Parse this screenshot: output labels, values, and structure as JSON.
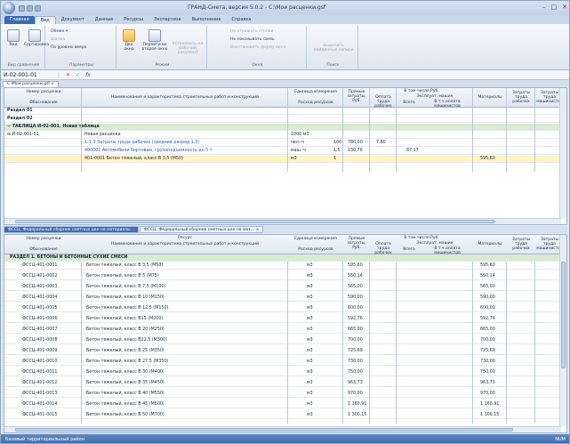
{
  "title": "ГРАНД-Смета, версия 5.0.2 - C:\\Мои расценки.gsf",
  "ribbon": {
    "tabs": [
      "Главная",
      "Вид",
      "Документ",
      "Данные",
      "Ресурсы",
      "Экспертиза",
      "Выполнение",
      "Справка"
    ],
    "groups": [
      {
        "label": "Вид сравнения",
        "buttons": [
          "Вид",
          "Сортировка"
        ]
      },
      {
        "label": "Параметры",
        "buttons": [
          "Обмен ▾",
          "Шапка",
          "По уровню вверх"
        ]
      },
      {
        "label": "Режим",
        "buttons": [
          "Два окна",
          "Перейти во второе окно",
          "Установить на рабочий документ"
        ]
      },
      {
        "label": "Окна",
        "buttons": [
          "Не отражать строки",
          "Не показывать связь",
          "Восстановить форму окна"
        ]
      },
      {
        "label": "Поиск",
        "buttons": [
          "Выделить найденные записи"
        ]
      }
    ]
  },
  "formula_bar": {
    "cell": "И-02-001-01",
    "value": ""
  },
  "doc_tab": "C:\\Мои расценки.gsf",
  "upper_table": {
    "headers": {
      "num": "Номер расценки",
      "basis": "Обоснование",
      "name": "Наименование и характеристика строительных работ и конструкций",
      "unit": "Единица измерения",
      "consumption": "Расход ресурсов",
      "direct": "Прямые затраты, Руб.",
      "incl": "В том числе,Руб.",
      "wage": "Оплата труда рабочих",
      "machines": "Эксплуат. машин",
      "total": "Всего",
      "incl_wage": "В т.ч.оплата машинистов",
      "materials": "Материалы",
      "labor_workers": "Затраты труда рабочих",
      "labor_machinists": "Затраты труда машинистов"
    },
    "rows": [
      {
        "type": "bold",
        "basis": "Раздел 01",
        "name": "",
        "unit": "",
        "cons": "",
        "direct": "",
        "wage": "",
        "total": "",
        "incl": "",
        "mat": ""
      },
      {
        "type": "bold",
        "basis": "Раздел 02",
        "name": "",
        "unit": "",
        "cons": "",
        "direct": "",
        "wage": "",
        "total": "",
        "incl": "",
        "mat": ""
      },
      {
        "type": "group",
        "basis": "−  ТАБЛИЦА И-02-001. Новая таблица",
        "name": "",
        "unit": "",
        "cons": "",
        "direct": "",
        "wage": "",
        "total": "",
        "incl": "",
        "mat": ""
      },
      {
        "type": "normal",
        "basis": "⊟  И-02-001-01",
        "name": "Новая расценка",
        "unit": "1000 м3",
        "cons": "",
        "direct": "",
        "wage": "",
        "total": "",
        "incl": "",
        "mat": ""
      },
      {
        "type": "blue",
        "basis": "",
        "name": "1-1-3 Затраты труда рабочих (средний разряд 1,3)",
        "unit": "чел.-ч",
        "cons": "100",
        "direct": "780,00",
        "wage": "7,80",
        "total": "",
        "incl": "",
        "mat": ""
      },
      {
        "type": "blue",
        "basis": "",
        "name": "400001 Автомобили бортовые, грузоподъемность до 5 т",
        "unit": "маш.-ч",
        "cons": "1,5",
        "direct": "130,76",
        "wage": "",
        "total": "87,17",
        "incl": "",
        "mat": ""
      },
      {
        "type": "sel",
        "basis": "",
        "name": "401-0001 Бетон тяжелый, класс В 3,5 (М50)",
        "unit": "м3",
        "cons": "1",
        "direct": "",
        "wage": "",
        "total": "",
        "incl": "",
        "mat": "595,60"
      }
    ]
  },
  "lower_tabs": [
    "ФССЦ. Федеральный сборник сметных цен на материалы...",
    "ФССЦ. Федеральный сборник сметных цен на мат...  ×"
  ],
  "lower_table": {
    "headers": {
      "num": "Номер расценки",
      "basis": "Обоснование",
      "resource": "Ресурс",
      "name": "Наименование и характеристика строительных работ и конструкций",
      "unit": "Единица измерения",
      "consumption": "Расход ресурсов",
      "direct": "Прямые затраты, Руб.",
      "incl": "В том числе,Руб.",
      "wage": "Оплата труда рабочих",
      "machines": "Эксплуат. машин",
      "total": "Всего",
      "incl_wage": "В т.ч.оплата машинистов",
      "materials": "Материалы",
      "labor_workers": "Затраты труда рабочих",
      "labor_machinists": "Затраты труда машинистов"
    },
    "section": "РАЗДЕЛ 1. БЕТОНЫ И БЕТОННЫЕ СУХИЕ СМЕСИ",
    "rows": [
      {
        "code": "ФССЦ-401-0001",
        "name": "Бетон тяжелый, класс В 3,5 (М50)",
        "unit": "м3",
        "direct": "595,60",
        "mat": "595,60"
      },
      {
        "code": "ФССЦ-401-0002",
        "name": "Бетон тяжелый, класс В 5 (М75)",
        "unit": "м3",
        "direct": "550,14",
        "mat": "550,14"
      },
      {
        "code": "ФССЦ-401-0003",
        "name": "Бетон тяжелый, класс В 7,5 (М100)",
        "unit": "м3",
        "direct": "565,00",
        "mat": "565,00"
      },
      {
        "code": "ФССЦ-401-0004",
        "name": "Бетон тяжелый, класс В 10 (М150)",
        "unit": "м3",
        "direct": "590,00",
        "mat": "590,00"
      },
      {
        "code": "ФССЦ-401-0005",
        "name": "Бетон тяжелый, класс В 12,5 (М150)",
        "unit": "м3",
        "direct": "600,00",
        "mat": "600,00"
      },
      {
        "code": "ФССЦ-401-0006",
        "name": "Бетон тяжелый, класс В15 (М200)",
        "unit": "м3",
        "direct": "592,76",
        "mat": "592,76"
      },
      {
        "code": "ФССЦ-401-0007",
        "name": "Бетон тяжелый, класс В 20 (М250)",
        "unit": "м3",
        "direct": "665,00",
        "mat": "665,00"
      },
      {
        "code": "ФССЦ-401-0008",
        "name": "Бетон тяжелый, класс В22,5 (М300)",
        "unit": "м3",
        "direct": "700,00",
        "mat": "700,00"
      },
      {
        "code": "ФССЦ-401-0009",
        "name": "Бетон тяжелый, класс В 25 (М350)",
        "unit": "м3",
        "direct": "725,69",
        "mat": "725,69"
      },
      {
        "code": "ФССЦ-401-0010",
        "name": "Бетон тяжелый, класс В 27,5 (М350)",
        "unit": "м3",
        "direct": "730,00",
        "mat": "730,00"
      },
      {
        "code": "ФССЦ-401-0011",
        "name": "Бетон тяжелый, класс В 30 (М400)",
        "unit": "м3",
        "direct": "750,00",
        "mat": "750,00"
      },
      {
        "code": "ФССЦ-401-0012",
        "name": "Бетон тяжелый, класс В 35 (М450)",
        "unit": "м3",
        "direct": "963,73",
        "mat": "963,73"
      },
      {
        "code": "ФССЦ-401-0013",
        "name": "Бетон тяжелый, класс В 40 (М550)",
        "unit": "м3",
        "direct": "970,00",
        "mat": "970,00"
      },
      {
        "code": "ФССЦ-401-0014",
        "name": "Бетон тяжелый, класс В 45 (М600)",
        "unit": "м3",
        "direct": "1 160,91",
        "mat": "1 160,91"
      },
      {
        "code": "ФССЦ-401-0015",
        "name": "Бетон тяжелый, класс В 50 (М700)",
        "unit": "м3",
        "direct": "1 300,15",
        "mat": "1 300,15"
      }
    ]
  },
  "status": {
    "left": "Базовый территориальный район",
    "right": "NUM"
  }
}
